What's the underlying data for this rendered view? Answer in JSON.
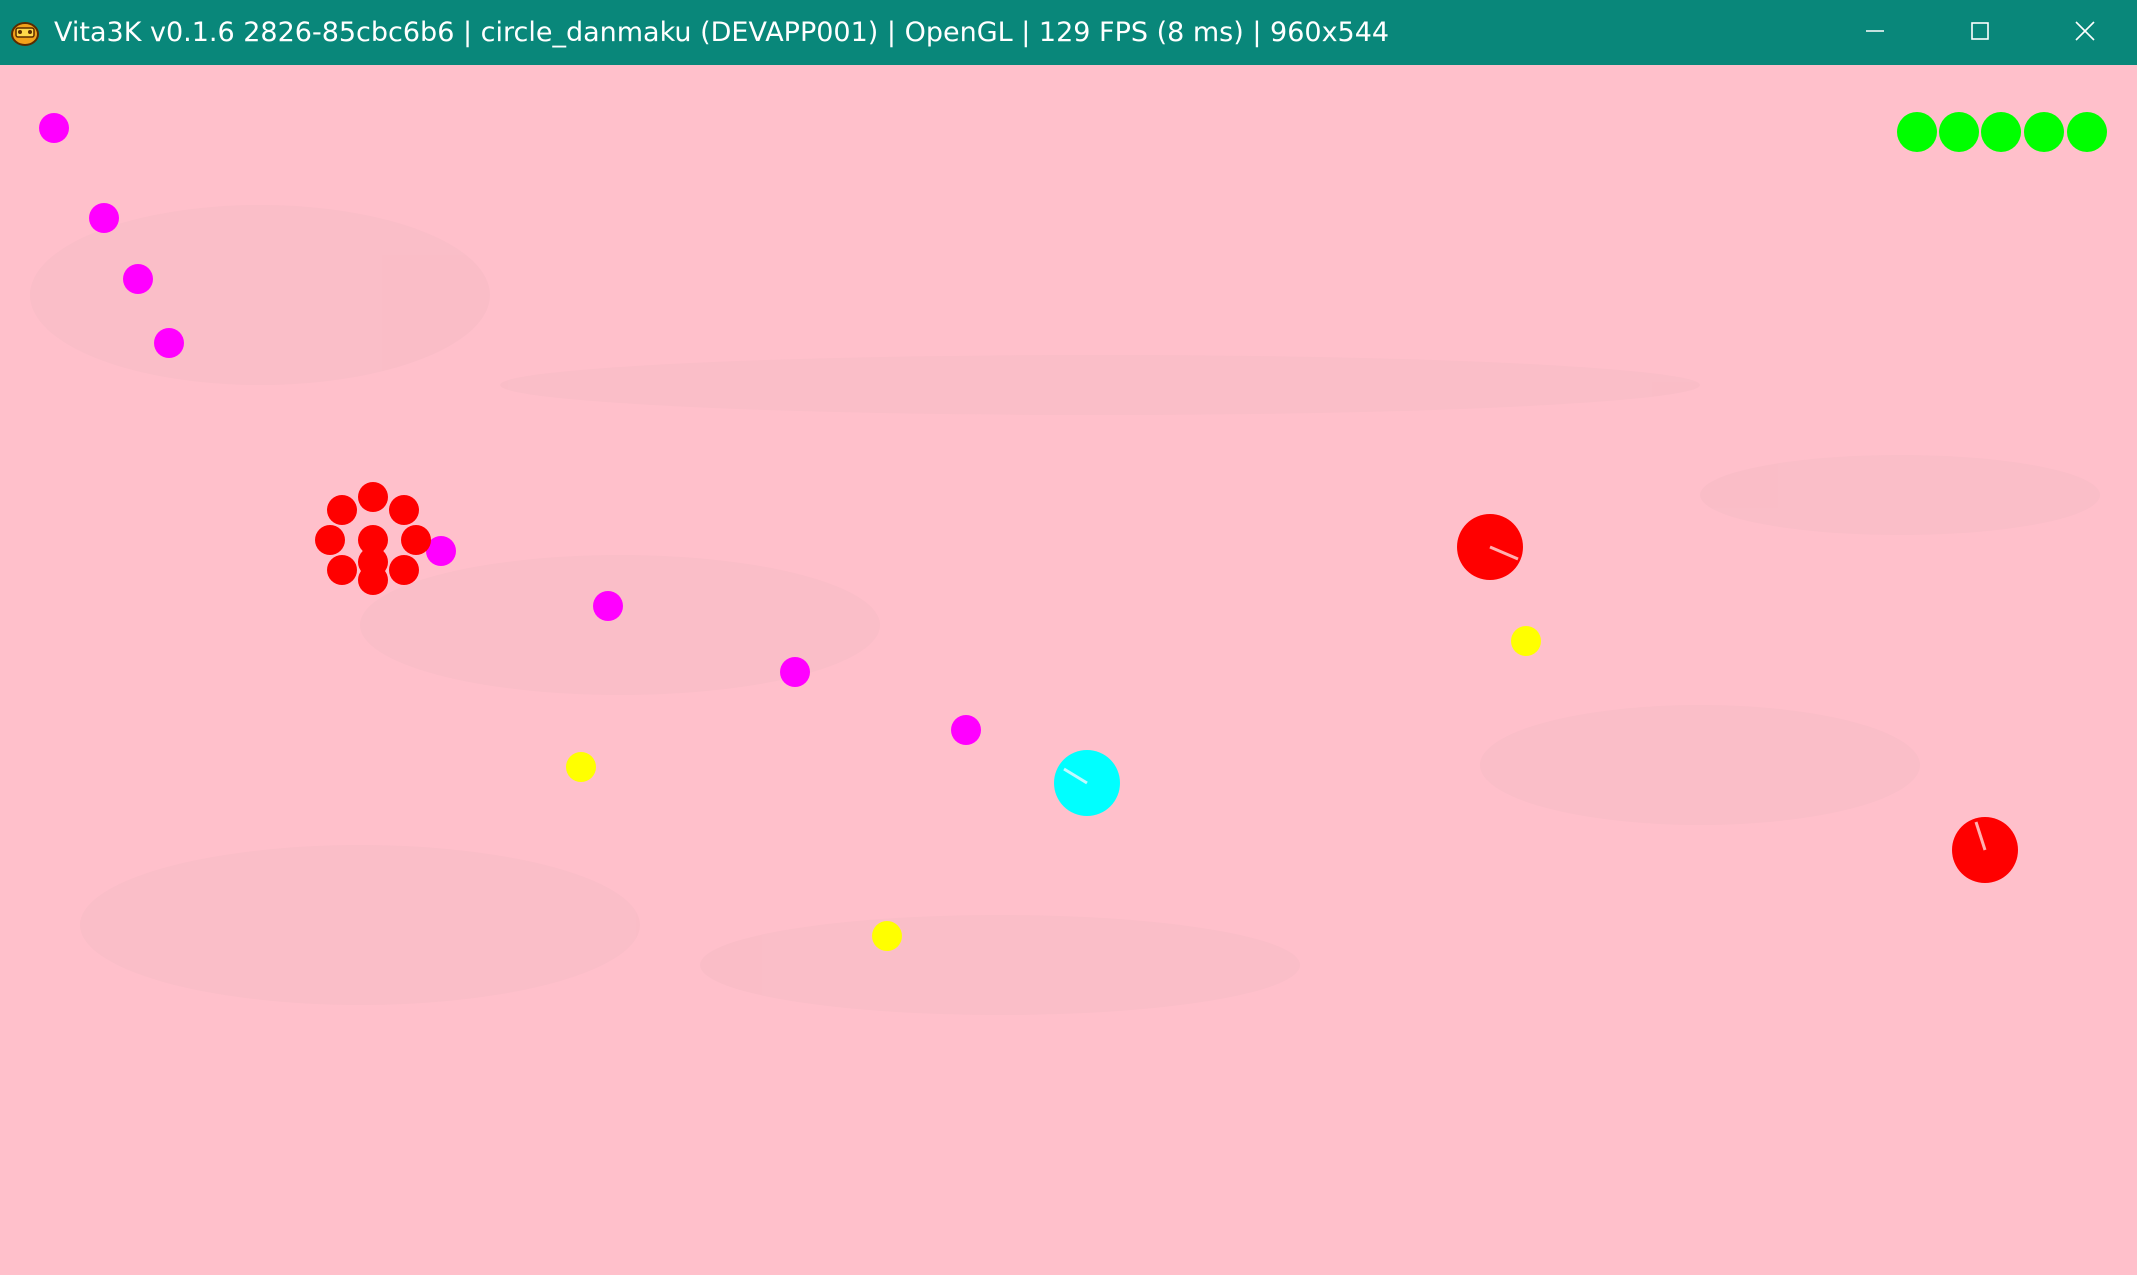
{
  "window": {
    "title": "Vita3K v0.1.6 2826-85cbc6b6 | circle_danmaku (DEVAPP001) | OpenGL | 129 FPS (8 ms) | 960x544",
    "icons": {
      "app": "vita3k-logo-icon",
      "minimize": "minimize-icon",
      "maximize": "maximize-icon",
      "close": "close-icon"
    }
  },
  "colors": {
    "titlebar": "#09877a",
    "background": "#ffc0cb",
    "player": "#00ffff",
    "enemy": "#ff0000",
    "bullet_magenta": "#ff00ff",
    "bullet_yellow": "#ffff00",
    "life": "#00ff00"
  },
  "game": {
    "lives": 5
  }
}
